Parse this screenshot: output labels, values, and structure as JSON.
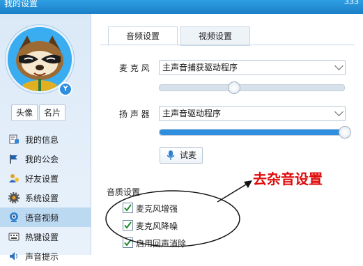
{
  "window": {
    "title": "我的设置",
    "corner_text": "ЗЗЗ"
  },
  "sidebar": {
    "avatar_badge": "Y",
    "buttons": [
      {
        "label": "头像"
      },
      {
        "label": "名片"
      }
    ],
    "items": [
      {
        "label": "我的信息",
        "icon": "info-icon"
      },
      {
        "label": "我的公会",
        "icon": "flag-icon"
      },
      {
        "label": "好友设置",
        "icon": "friends-icon"
      },
      {
        "label": "系统设置",
        "icon": "gear-icon"
      },
      {
        "label": "语音视频",
        "icon": "camera-icon",
        "active": true
      },
      {
        "label": "热键设置",
        "icon": "keyboard-icon"
      },
      {
        "label": "声音提示",
        "icon": "speaker-icon"
      }
    ]
  },
  "tabs": [
    {
      "label": "音频设置",
      "active": true
    },
    {
      "label": "视频设置",
      "active": false
    }
  ],
  "audio": {
    "microphone": {
      "label": "麦 克 风",
      "selected": "主声音捕获驱动程序",
      "level": 0.4
    },
    "speaker": {
      "label": "扬 声 器",
      "selected": "主声音驱动程序",
      "level": 1.0
    },
    "test_button": "试麦"
  },
  "quality": {
    "title": "音质设置",
    "options": [
      {
        "label": "麦克风增强",
        "checked": true
      },
      {
        "label": "麦克风降噪",
        "checked": true
      },
      {
        "label": "启用回声消除",
        "checked": true
      }
    ]
  },
  "annotation": {
    "text": "去杂音设置",
    "color": "#e00a0a"
  }
}
